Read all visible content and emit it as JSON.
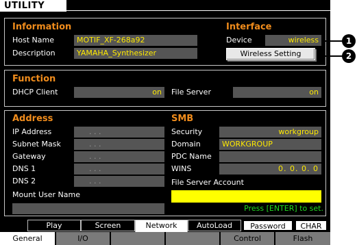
{
  "title": "UTILITY",
  "information": {
    "heading": "Information",
    "host_name_label": "Host Name",
    "host_name_value": "MOTIF_XF-268a92",
    "description_label": "Description",
    "description_value": "YAMAHA_Synthesizer"
  },
  "interface": {
    "heading": "Interface",
    "device_label": "Device",
    "device_value": "wireless",
    "wireless_setting_button": "Wireless Setting"
  },
  "function": {
    "heading": "Function",
    "dhcp_label": "DHCP Client",
    "dhcp_value": "on",
    "file_server_label": "File Server",
    "file_server_value": "on"
  },
  "address": {
    "heading": "Address",
    "ip_label": "IP Address",
    "subnet_label": "Subnet Mask",
    "gateway_label": "Gateway",
    "dns1_label": "DNS 1",
    "dns2_label": "DNS 2",
    "empty_ip_placeholder": ".     .     .",
    "mount_user_label": "Mount User Name",
    "mount_user_value": ""
  },
  "smb": {
    "heading": "SMB",
    "security_label": "Security",
    "security_value": "workgroup",
    "domain_label": "Domain",
    "domain_value": "WORKGROUP",
    "pdc_label": "PDC Name",
    "pdc_value": "",
    "wins_label": "WINS",
    "wins_value": "0.   0.   0.   0",
    "account_label": "File Server Account",
    "account_value": "",
    "press_hint": "Press [ENTER] to set."
  },
  "tabs_row1": [
    "Play",
    "Screen",
    "Network",
    "AutoLoad",
    "Password",
    "CHAR"
  ],
  "tabs_row2": [
    "General",
    "I/O",
    "Control",
    "Flash"
  ],
  "callouts": [
    "1",
    "2"
  ]
}
